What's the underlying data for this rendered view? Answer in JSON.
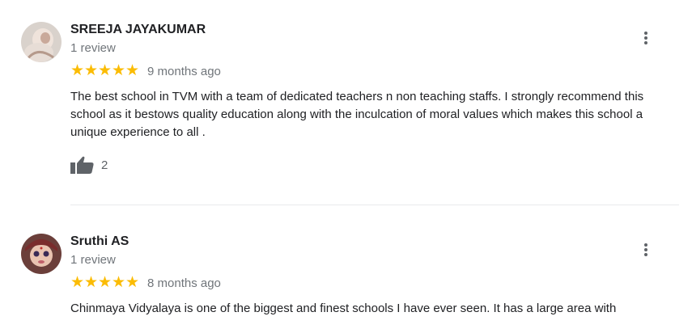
{
  "reviews": [
    {
      "name": "SREEJA JAYAKUMAR",
      "review_count": "1 review",
      "stars": "★★★★★",
      "date": "9 months ago",
      "text": "The best school in TVM  with a team of dedicated teachers n non teaching staffs. I strongly recommend this school as it bestows quality education along with the inculcation of moral values which makes this school a unique experience to all .",
      "likes": "2",
      "rating": 5
    },
    {
      "name": "Sruthi AS",
      "review_count": "1 review",
      "stars": "★★★★★",
      "date": "8 months ago",
      "text": "Chinmaya Vidyalaya is one of the biggest and finest schools I have ever seen. It has a large area with",
      "rating": 5
    }
  ],
  "colors": {
    "star": "#fbbc04",
    "secondary_text": "#70757a",
    "primary_text": "#202124"
  },
  "icons": {
    "like": "thumb-up-icon",
    "more": "more-vert-icon"
  }
}
